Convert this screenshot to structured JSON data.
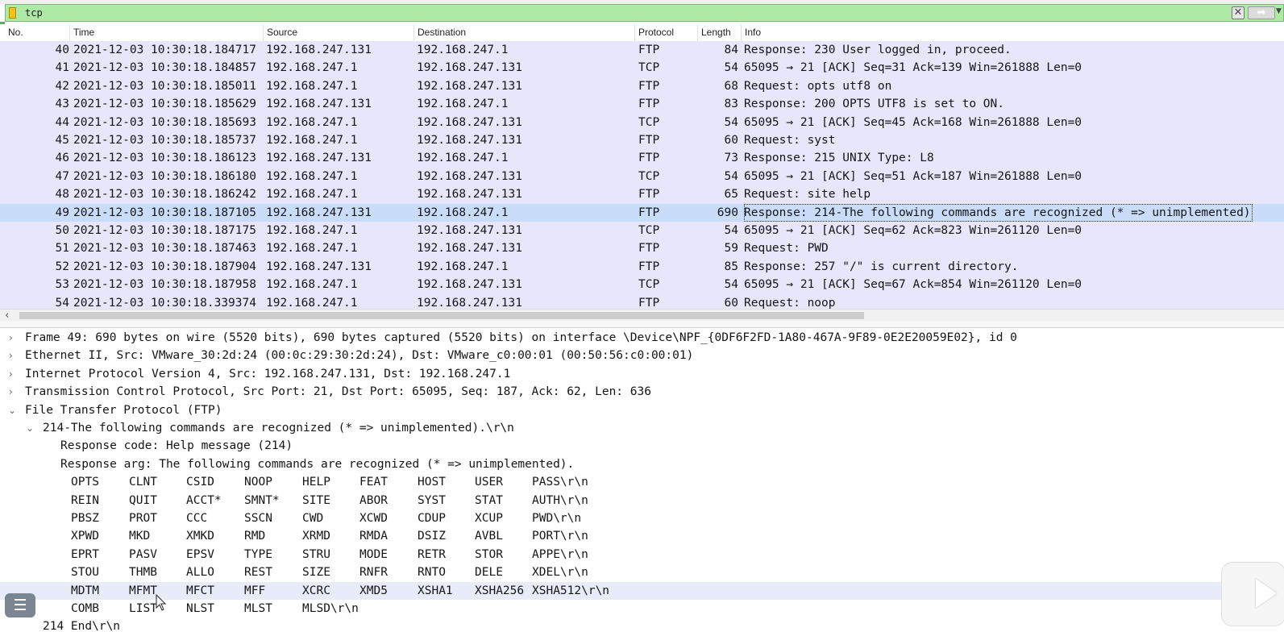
{
  "filter": {
    "value": "tcp"
  },
  "columns": [
    "No.",
    "Time",
    "Source",
    "Destination",
    "Protocol",
    "Length",
    "Info"
  ],
  "packets": [
    {
      "no": "40",
      "time": "2021-12-03 10:30:18.184717",
      "src": "192.168.247.131",
      "dst": "192.168.247.1",
      "proto": "FTP",
      "len": "84",
      "info": "Response: 230 User logged in, proceed."
    },
    {
      "no": "41",
      "time": "2021-12-03 10:30:18.184857",
      "src": "192.168.247.1",
      "dst": "192.168.247.131",
      "proto": "TCP",
      "len": "54",
      "info": "65095 → 21 [ACK] Seq=31 Ack=139 Win=261888 Len=0"
    },
    {
      "no": "42",
      "time": "2021-12-03 10:30:18.185011",
      "src": "192.168.247.1",
      "dst": "192.168.247.131",
      "proto": "FTP",
      "len": "68",
      "info": "Request: opts utf8 on"
    },
    {
      "no": "43",
      "time": "2021-12-03 10:30:18.185629",
      "src": "192.168.247.131",
      "dst": "192.168.247.1",
      "proto": "FTP",
      "len": "83",
      "info": "Response: 200 OPTS UTF8 is set to ON."
    },
    {
      "no": "44",
      "time": "2021-12-03 10:30:18.185693",
      "src": "192.168.247.1",
      "dst": "192.168.247.131",
      "proto": "TCP",
      "len": "54",
      "info": "65095 → 21 [ACK] Seq=45 Ack=168 Win=261888 Len=0"
    },
    {
      "no": "45",
      "time": "2021-12-03 10:30:18.185737",
      "src": "192.168.247.1",
      "dst": "192.168.247.131",
      "proto": "FTP",
      "len": "60",
      "info": "Request: syst"
    },
    {
      "no": "46",
      "time": "2021-12-03 10:30:18.186123",
      "src": "192.168.247.131",
      "dst": "192.168.247.1",
      "proto": "FTP",
      "len": "73",
      "info": "Response: 215 UNIX Type: L8"
    },
    {
      "no": "47",
      "time": "2021-12-03 10:30:18.186180",
      "src": "192.168.247.1",
      "dst": "192.168.247.131",
      "proto": "TCP",
      "len": "54",
      "info": "65095 → 21 [ACK] Seq=51 Ack=187 Win=261888 Len=0"
    },
    {
      "no": "48",
      "time": "2021-12-03 10:30:18.186242",
      "src": "192.168.247.1",
      "dst": "192.168.247.131",
      "proto": "FTP",
      "len": "65",
      "info": "Request: site help"
    },
    {
      "no": "49",
      "time": "2021-12-03 10:30:18.187105",
      "src": "192.168.247.131",
      "dst": "192.168.247.1",
      "proto": "FTP",
      "len": "690",
      "info": "Response: 214-The following commands are recognized (* => unimplemented)"
    },
    {
      "no": "50",
      "time": "2021-12-03 10:30:18.187175",
      "src": "192.168.247.1",
      "dst": "192.168.247.131",
      "proto": "TCP",
      "len": "54",
      "info": "65095 → 21 [ACK] Seq=62 Ack=823 Win=261120 Len=0"
    },
    {
      "no": "51",
      "time": "2021-12-03 10:30:18.187463",
      "src": "192.168.247.1",
      "dst": "192.168.247.131",
      "proto": "FTP",
      "len": "59",
      "info": "Request: PWD"
    },
    {
      "no": "52",
      "time": "2021-12-03 10:30:18.187904",
      "src": "192.168.247.131",
      "dst": "192.168.247.1",
      "proto": "FTP",
      "len": "85",
      "info": "Response: 257 \"/\" is current directory."
    },
    {
      "no": "53",
      "time": "2021-12-03 10:30:18.187958",
      "src": "192.168.247.1",
      "dst": "192.168.247.131",
      "proto": "TCP",
      "len": "54",
      "info": "65095 → 21 [ACK] Seq=67 Ack=854 Win=261120 Len=0"
    },
    {
      "no": "54",
      "time": "2021-12-03 10:30:18.339374",
      "src": "192.168.247.1",
      "dst": "192.168.247.131",
      "proto": "FTP",
      "len": "60",
      "info": "Request: noop"
    }
  ],
  "selected_packet": "49",
  "details": {
    "frame": "Frame 49: 690 bytes on wire (5520 bits), 690 bytes captured (5520 bits) on interface \\Device\\NPF_{0DF6F2FD-1A80-467A-9F89-0E2E20059E02}, id 0",
    "ethernet": "Ethernet II, Src: VMware_30:2d:24 (00:0c:29:30:2d:24), Dst: VMware_c0:00:01 (00:50:56:c0:00:01)",
    "ip": "Internet Protocol Version 4, Src: 192.168.247.131, Dst: 192.168.247.1",
    "tcp": "Transmission Control Protocol, Src Port: 21, Dst Port: 65095, Seq: 187, Ack: 62, Len: 636",
    "ftp": "File Transfer Protocol (FTP)",
    "ftp_line": "214-The following commands are recognized (* => unimplemented).\\r\\n",
    "response_code": "Response code: Help message (214)",
    "response_arg": "Response arg: The following commands are recognized (* => unimplemented).",
    "command_rows": [
      [
        "OPTS",
        "CLNT",
        "CSID",
        "NOOP",
        "HELP",
        "FEAT",
        "HOST",
        "USER",
        "PASS\\r\\n"
      ],
      [
        "REIN",
        "QUIT",
        "ACCT*",
        "SMNT*",
        "SITE",
        "ABOR",
        "SYST",
        "STAT",
        "AUTH\\r\\n"
      ],
      [
        "PBSZ",
        "PROT",
        "CCC",
        "SSCN",
        "CWD",
        "XCWD",
        "CDUP",
        "XCUP",
        "PWD\\r\\n"
      ],
      [
        "XPWD",
        "MKD",
        "XMKD",
        "RMD",
        "XRMD",
        "RMDA",
        "DSIZ",
        "AVBL",
        "PORT\\r\\n"
      ],
      [
        "EPRT",
        "PASV",
        "EPSV",
        "TYPE",
        "STRU",
        "MODE",
        "RETR",
        "STOR",
        "APPE\\r\\n"
      ],
      [
        "STOU",
        "THMB",
        "ALLO",
        "REST",
        "SIZE",
        "RNFR",
        "RNTO",
        "DELE",
        "XDEL\\r\\n"
      ],
      [
        "MDTM",
        "MFMT",
        "MFCT",
        "MFF",
        "XCRC",
        "XMD5",
        "XSHA1",
        "XSHA256",
        "XSHA512\\r\\n"
      ],
      [
        "COMB",
        "LIST",
        "NLST",
        "MLST",
        "MLSD\\r\\n"
      ]
    ],
    "last_partial": "214 End\\r\\n"
  },
  "icons": {
    "menu": "menu-icon",
    "play": "play-icon",
    "bookmark": "filter-bookmark-icon",
    "clear": "clear-filter-icon",
    "apply": "apply-filter-icon"
  },
  "colors": {
    "filter_bg": "#aee9a6",
    "packet_bg": "#e7e6fb",
    "selected_bg": "#c9dcfa"
  }
}
